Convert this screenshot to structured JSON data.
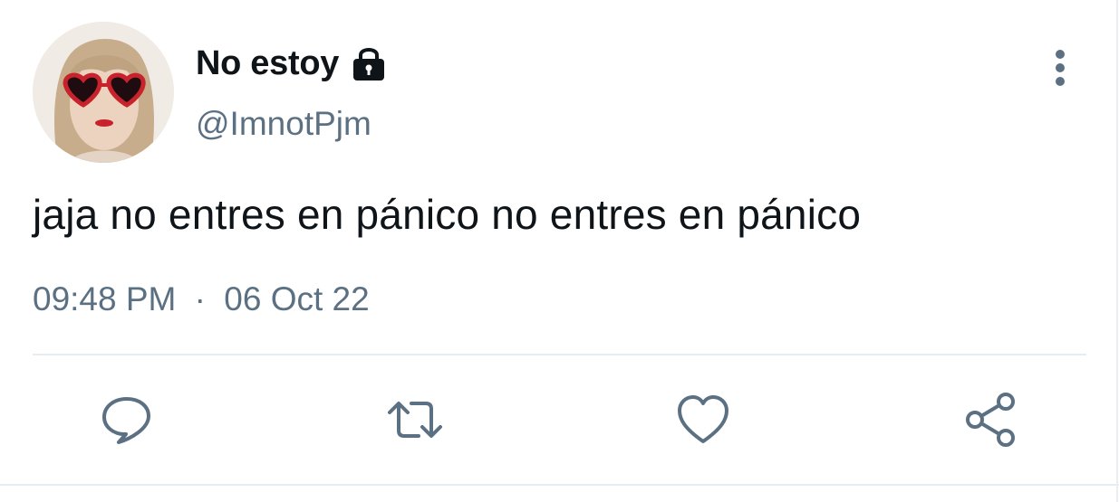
{
  "user": {
    "display_name": "No estoy",
    "handle": "@ImnotPjm",
    "protected_icon": "lock-icon",
    "avatar_icon": "avatar-photo"
  },
  "tweet": {
    "text": "jaja no entres en pánico no entres en pánico",
    "time": "09:48 PM",
    "separator": "·",
    "date": "06 Oct 22"
  },
  "actions": [
    {
      "name": "reply",
      "icon": "reply-icon"
    },
    {
      "name": "retweet",
      "icon": "retweet-icon"
    },
    {
      "name": "like",
      "icon": "heart-icon"
    },
    {
      "name": "share",
      "icon": "share-icon"
    }
  ],
  "menu": {
    "icon": "more-vertical-icon"
  },
  "colors": {
    "primary_text": "#0f1419",
    "secondary_text": "#5b7083",
    "divider": "#e6ecf0",
    "icon": "#5b7083"
  }
}
